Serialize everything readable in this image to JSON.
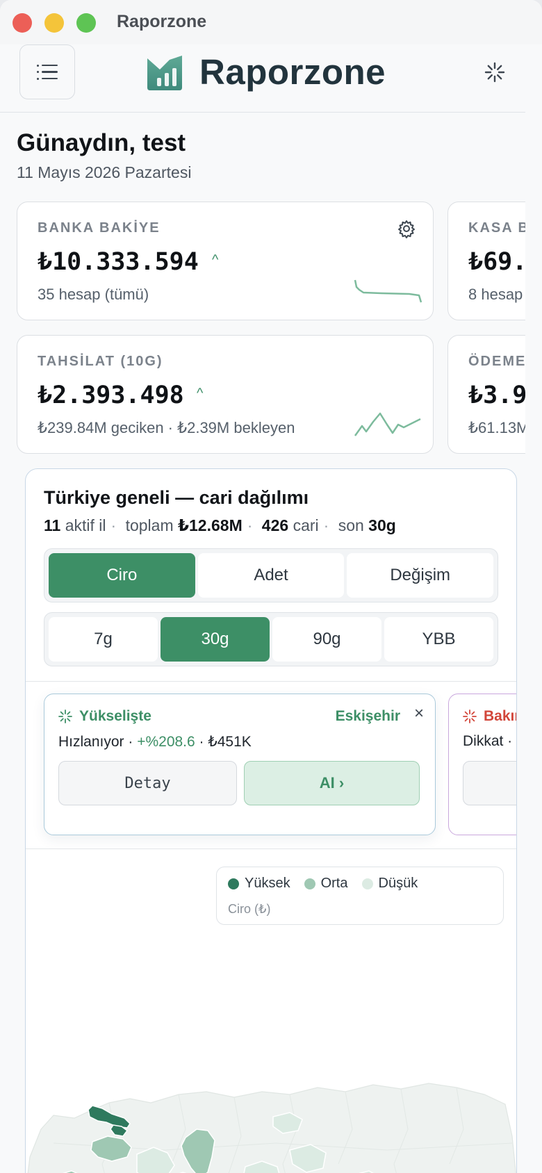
{
  "window": {
    "title": "Raporzone"
  },
  "header": {
    "brand": "Raporzone"
  },
  "greeting": {
    "title": "Günaydın, test",
    "date": "11 Mayıs 2026 Pazartesi"
  },
  "cards": [
    {
      "label": "BANKA BAKİYE",
      "value": "₺10.333.594",
      "trend": "^",
      "sub": "35 hesap (tümü)"
    },
    {
      "label": "KASA BAKİYE",
      "value": "₺69.",
      "sub": "8 hesap"
    },
    {
      "label": "TAHSİLAT (10G)",
      "value": "₺2.393.498",
      "trend": "^",
      "sub": "₺239.84M geciken · ₺2.39M bekleyen"
    },
    {
      "label": "ÖDEME",
      "value": "₺3.9",
      "sub": "₺61.13M"
    }
  ],
  "map_panel": {
    "title": "Türkiye geneli — cari dağılımı",
    "meta": {
      "provinces_count": "11",
      "provinces_label": "aktif il",
      "total_label": "toplam",
      "total_value": "₺12.68M",
      "accounts_count": "426",
      "accounts_label": "cari",
      "period_label": "son",
      "period_value": "30g"
    },
    "metric_tabs": [
      "Ciro",
      "Adet",
      "Değişim"
    ],
    "metric_active": "Ciro",
    "period_tabs": [
      "7g",
      "30g",
      "90g",
      "YBB"
    ],
    "period_active": "30g",
    "insights": [
      {
        "tag": "Yükselişte",
        "city": "Eskişehir",
        "status": "Hızlanıyor",
        "change": "+%208.6",
        "amount": "₺451K",
        "detail_label": "Detay",
        "ai_label": "AI ›",
        "close": "×"
      },
      {
        "tag": "Bakır",
        "status": "Dikkat ·"
      }
    ],
    "legend": {
      "items": [
        {
          "label": "Yüksek",
          "color": "#2f7a5e"
        },
        {
          "label": "Orta",
          "color": "#9fc8b3"
        },
        {
          "label": "Düşük",
          "color": "#dcebe3"
        }
      ],
      "unit": "Ciro (₺)"
    }
  },
  "colors": {
    "accent": "#3d8f66",
    "warning": "#d2463a",
    "border": "#c8d7e6"
  }
}
